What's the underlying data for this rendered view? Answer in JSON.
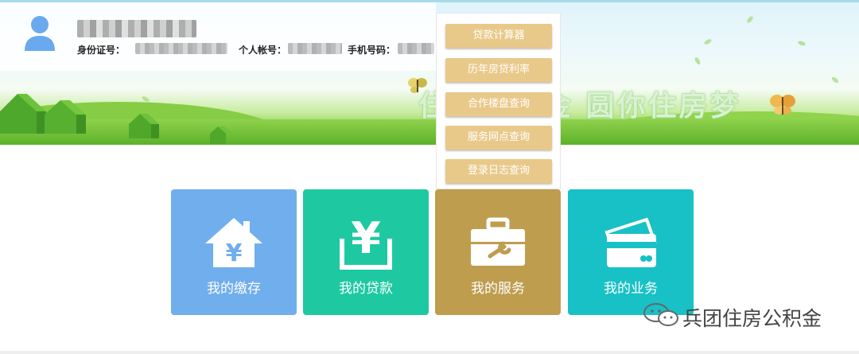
{
  "header": {
    "id_label": "身份证号：",
    "account_label": "个人帐号：",
    "phone_label": "手机号码：",
    "slogan": "住房公积金  圆你住房梦"
  },
  "dropdown_menu": {
    "items": [
      "贷款计算器",
      "历年房贷利率",
      "合作楼盘查询",
      "服务网点查询",
      "登录日志查询"
    ]
  },
  "tiles": [
    {
      "label": "我的缴存",
      "icon": "house-yen-icon",
      "color": "#70aeed"
    },
    {
      "label": "我的贷款",
      "icon": "yen-tray-icon",
      "color": "#1ec9a1"
    },
    {
      "label": "我的服务",
      "icon": "toolbox-icon",
      "color": "#be9d4e"
    },
    {
      "label": "我的业务",
      "icon": "cards-icon",
      "color": "#18c1c5"
    }
  ],
  "watermark": {
    "text": "兵团住房公积金",
    "icon": "wechat-icon"
  },
  "colors": {
    "dropdown_button": "#e9c98a",
    "banner_grass": "#6cbf35"
  }
}
